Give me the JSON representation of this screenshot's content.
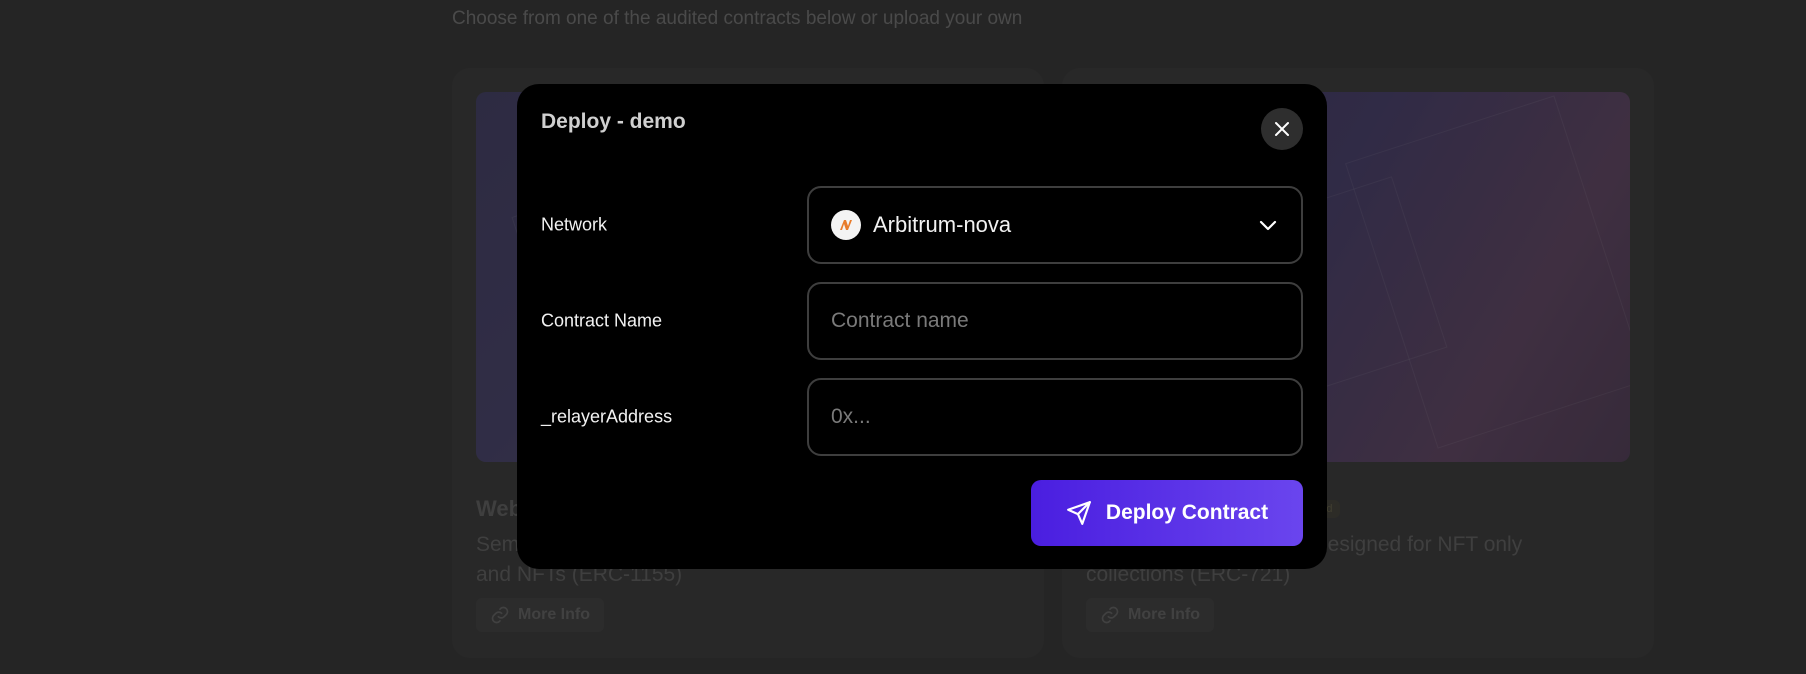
{
  "background": {
    "subtitle": "Choose from one of the audited contracts below or upload your own",
    "cards": [
      {
        "title": "Web",
        "description": "Sem... and NFTs (ERC-1155)",
        "desc_line1": "Sem",
        "desc_line2": "and NFTs (ERC-1155)",
        "more_info": "More Info"
      },
      {
        "badge": "...ted",
        "desc_line1": "designed for NFT only",
        "desc_line2": "collections (ERC-721)",
        "more_info": "More Info"
      }
    ]
  },
  "modal": {
    "title": "Deploy - demo",
    "fields": {
      "network": {
        "label": "Network",
        "value": "Arbitrum-nova",
        "icon": "arbitrum-nova-icon"
      },
      "contract_name": {
        "label": "Contract Name",
        "placeholder": "Contract name",
        "value": ""
      },
      "relayer_address": {
        "label": "_relayerAddress",
        "placeholder": "0x...",
        "value": ""
      }
    },
    "deploy_button": {
      "label": "Deploy Contract",
      "icon": "send-icon"
    },
    "close_icon": "close-icon"
  },
  "colors": {
    "accent_start": "#4a1ee0",
    "accent_end": "#6a45ee",
    "network_icon": "#e87c2c"
  }
}
